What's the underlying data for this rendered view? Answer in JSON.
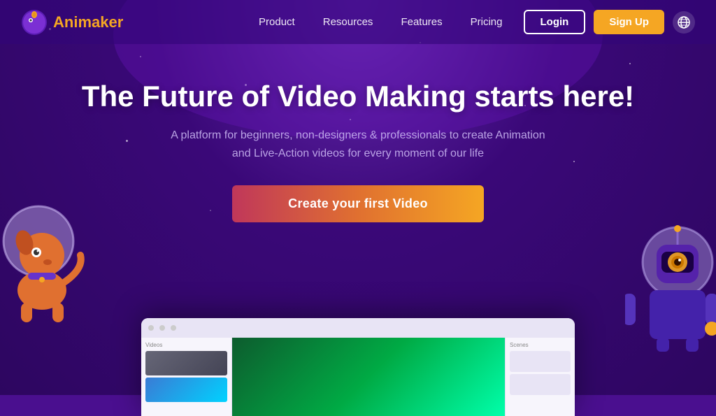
{
  "brand": {
    "name": "Animaker",
    "logoAlt": "Animaker logo"
  },
  "nav": {
    "links": [
      {
        "label": "Product",
        "id": "product"
      },
      {
        "label": "Resources",
        "id": "resources"
      },
      {
        "label": "Features",
        "id": "features"
      },
      {
        "label": "Pricing",
        "id": "pricing"
      }
    ],
    "loginLabel": "Login",
    "signupLabel": "Sign Up",
    "globeAlt": "Language selector"
  },
  "hero": {
    "title": "The Future of Video Making starts here!",
    "subtitle_line1": "A platform for beginners, non-designers & professionals to create Animation",
    "subtitle_line2": "and Live-Action videos for every moment of our life",
    "ctaLabel": "Create your first Video"
  },
  "colors": {
    "background": "#3a0878",
    "accent_orange": "#f5a623",
    "cta_gradient_start": "#c0375a",
    "cta_gradient_end": "#f5a623",
    "nav_bg": "rgba(50,5,120,0.6)"
  },
  "appPreview": {
    "alt": "Animaker app interface preview"
  }
}
